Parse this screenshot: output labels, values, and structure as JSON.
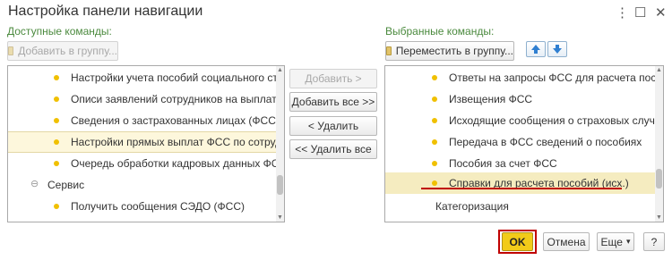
{
  "window": {
    "title": "Настройка панели навигации",
    "more_icon": "⋮",
    "maximize_icon": "☐",
    "close_icon": "✕"
  },
  "available": {
    "label": "Доступные команды:",
    "add_to_group_label": "Добавить в группу...",
    "items": [
      {
        "text": "Настройки учета пособий социального страхова",
        "type": "item"
      },
      {
        "text": "Описи заявлений сотрудников на выплату пособ",
        "type": "item"
      },
      {
        "text": "Сведения о застрахованных лицах (ФСС)",
        "type": "item"
      },
      {
        "text": "Настройки прямых выплат ФСС по сотрудникам",
        "type": "item",
        "highlighted": true
      },
      {
        "text": "Очередь обработки кадровых данных ФСС",
        "type": "item"
      },
      {
        "text": "Сервис",
        "type": "group"
      },
      {
        "text": "Получить сообщения СЭДО (ФСС)",
        "type": "item"
      }
    ]
  },
  "middle": {
    "add": "Добавить >",
    "add_all": "Добавить все >>",
    "remove": "< Удалить",
    "remove_all": "<< Удалить все"
  },
  "selected": {
    "label": "Выбранные команды:",
    "move_to_group_label": "Переместить в группу...",
    "items": [
      {
        "text": "Ответы на запросы ФСС для расчета пособий",
        "type": "item"
      },
      {
        "text": "Извещения ФСС",
        "type": "item"
      },
      {
        "text": "Исходящие сообщения о страховых случаях ФС",
        "type": "item"
      },
      {
        "text": "Передача в ФСС сведений о пособиях",
        "type": "item"
      },
      {
        "text": "Пособия за счет ФСС",
        "type": "item"
      },
      {
        "text": "Справки для расчета пособий (исх.)",
        "type": "item",
        "selected": true
      },
      {
        "text": "Категоризация",
        "type": "group"
      }
    ]
  },
  "footer": {
    "ok": "OK",
    "cancel": "Отмена",
    "more": "Еще",
    "more_arrow": "▾",
    "help": "?"
  },
  "colors": {
    "accent_yellow": "#f2cb19",
    "label_green": "#4b8a3e",
    "annotation_red": "#c00000",
    "bullet": "#f0c000",
    "arrow_blue": "#2f7fd1"
  }
}
